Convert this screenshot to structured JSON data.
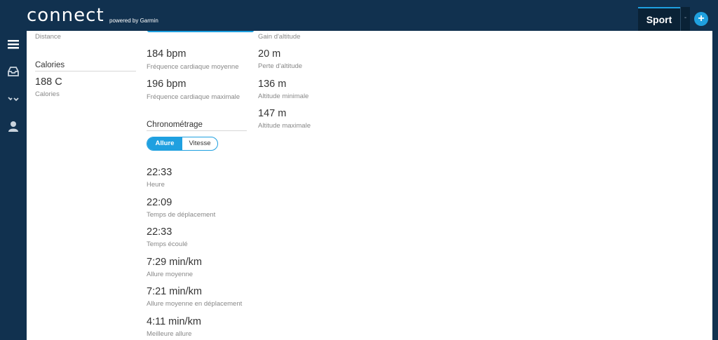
{
  "header": {
    "logo": "connect",
    "logo_sub": "powered by Garmin",
    "sport_tab": "Sport",
    "dropdown": "-",
    "plus": "+"
  },
  "sidebar": {
    "icons": [
      "menu-icon",
      "inbox-icon",
      "activity-icon",
      "user-icon"
    ]
  },
  "left_col": {
    "distance_label": "Distance",
    "calories_title": "Calories",
    "calories_value": "188 C",
    "calories_label": "Calories"
  },
  "hr": {
    "avg_value": "184 bpm",
    "avg_label": "Fréquence cardiaque moyenne",
    "max_value": "196 bpm",
    "max_label": "Fréquence cardiaque maximale"
  },
  "chrono": {
    "title": "Chronométrage",
    "toggle_pace": "Allure",
    "toggle_speed": "Vitesse",
    "items": [
      {
        "value": "22:33",
        "label": "Heure"
      },
      {
        "value": "22:09",
        "label": "Temps de déplacement"
      },
      {
        "value": "22:33",
        "label": "Temps écoulé"
      },
      {
        "value": "7:29 min/km",
        "label": "Allure moyenne"
      },
      {
        "value": "7:21 min/km",
        "label": "Allure moyenne en déplacement"
      },
      {
        "value": "4:11 min/km",
        "label": "Meilleure allure"
      }
    ]
  },
  "elevation": {
    "gain_label": "Gain d'altitude",
    "items": [
      {
        "value": "20 m",
        "label": "Perte d'altitude"
      },
      {
        "value": "136 m",
        "label": "Altitude minimale"
      },
      {
        "value": "147 m",
        "label": "Altitude maximale"
      }
    ]
  },
  "colors": {
    "accent": "#1fa0e0",
    "nav_bg": "#11314f"
  }
}
